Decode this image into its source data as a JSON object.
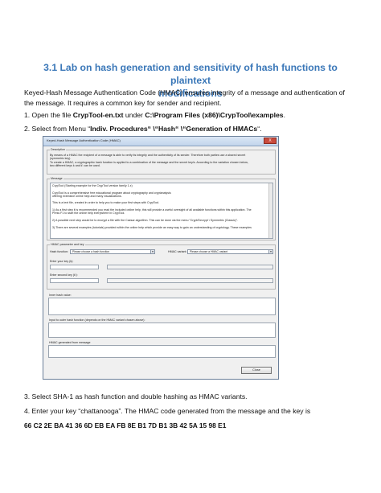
{
  "heading": {
    "line1": "3.1 Lab on hash generation and sensitivity of hash functions to plaintext",
    "line2": "modifications"
  },
  "intro": {
    "line1": "Keyed-Hash Message Authentication Code (HMAC) ensures integrity of a message and authentication of",
    "line2": "the message.  It requires a common key for sender and recipient."
  },
  "step1": {
    "prefix": "1. Open the file ",
    "file": "CrypTool-en.txt",
    "middle": " under ",
    "path": "C:\\Program Files (x86)\\CrypTool\\examples",
    "suffix": "."
  },
  "step2": {
    "prefix": "2. Select from Menu “",
    "menu": "Indiv. Procedures“ \\“Hash“ \\“Generation of HMACs",
    "suffix": "“."
  },
  "dialog": {
    "title": "Keyed-Hash Message Authentication Code (HMAC)",
    "close_label": "X",
    "description": {
      "label": "Description",
      "line1": "By means of a HMAC the recipient of a message is able to verify its integrity and the authenticity of its sender. Therefore both parties use a shared secret",
      "line2": "(symmetric key).",
      "line3": "To create a HMAC, a cryptographic hash function is applied to a combination of the message and the secret key/s. According to the variation chosen below,",
      "line4": "two different keys k and k' can be used."
    },
    "message": {
      "label": "Message",
      "lines": [
        "CrypTool (Starting example for the CrypTool version family 1.x)",
        "",
        "CrypTool is a comprehensive free educational program about cryptography and cryptanalysis",
        "offering extensive online help and many visualizations.",
        "",
        "This is a text file, created in order to help you to make your first steps with CrypTool.",
        "",
        "1) As a first step it is recommended you read the included online help, this will provide a useful oversight of all available functions within this application. The",
        "Press F1 to start the online help everywhere in CrypTool.",
        "",
        "2) A possible next step would be to encrypt a file with the Caesar algorithm. This can be done via the menu \"Crypt/Decrypt \\ Symmetric (Classic)\".",
        "",
        "3) There are several examples (tutorials) provided within the online help which provide an easy way to gain an understanding of cryptology. These examples"
      ]
    },
    "params": {
      "label": "HMAC parameter and key",
      "hash_function_label": "Hash function:",
      "hash_function_value": "Please choose a hash function",
      "variant_label": "HMAC variant:",
      "variant_value": "Please choose a HMAC variant",
      "key_label": "Enter your key (k):",
      "second_key_label": "Enter second key (k'):"
    },
    "inner_hash_label": "Inner hash value:",
    "outer_hash_label": "Input to outer hash function (depends on the HMAC variant chosen above):",
    "hmac_label": "HMAC generated from message",
    "close_button": "Close"
  },
  "step3": "3. Select SHA-1 as hash function and double hashing as HMAC variants.",
  "step4": "4. Enter your key “chattanooga”.  The HMAC code generated from the message and the key is",
  "hmac_value": "66 C2 2E BA 41 36 6D EB EA FB 8E B1 7D B1 3B 42 5A 15 98 E1"
}
